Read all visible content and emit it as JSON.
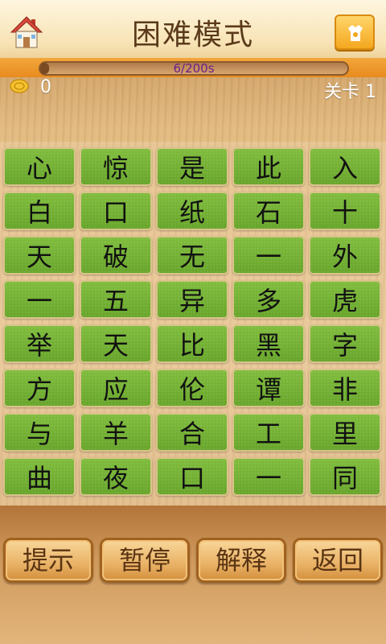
{
  "header": {
    "title": "困难模式"
  },
  "timer": {
    "text": "6/200s",
    "elapsed": 6,
    "total": 200
  },
  "stats": {
    "coins": "0",
    "level": "关卡 1"
  },
  "board": {
    "rows": [
      [
        "心",
        "惊",
        "是",
        "此",
        "入"
      ],
      [
        "白",
        "口",
        "纸",
        "石",
        "十"
      ],
      [
        "天",
        "破",
        "无",
        "一",
        "外"
      ],
      [
        "一",
        "五",
        "异",
        "多",
        "虎"
      ],
      [
        "举",
        "天",
        "比",
        "黑",
        "字"
      ],
      [
        "方",
        "应",
        "伦",
        "谭",
        "非"
      ],
      [
        "与",
        "羊",
        "合",
        "工",
        "里"
      ],
      [
        "曲",
        "夜",
        "口",
        "一",
        "同"
      ]
    ]
  },
  "buttons": {
    "hint": "提示",
    "pause": "暂停",
    "explain": "解释",
    "back": "返回"
  },
  "colors": {
    "tile": "#72b032",
    "band": "#ee9a2c",
    "title": "#5a3a1a",
    "timer_text": "#6a1f8a"
  },
  "icons": {
    "home": "home-icon",
    "share": "share-icon",
    "coin": "coin-icon"
  }
}
